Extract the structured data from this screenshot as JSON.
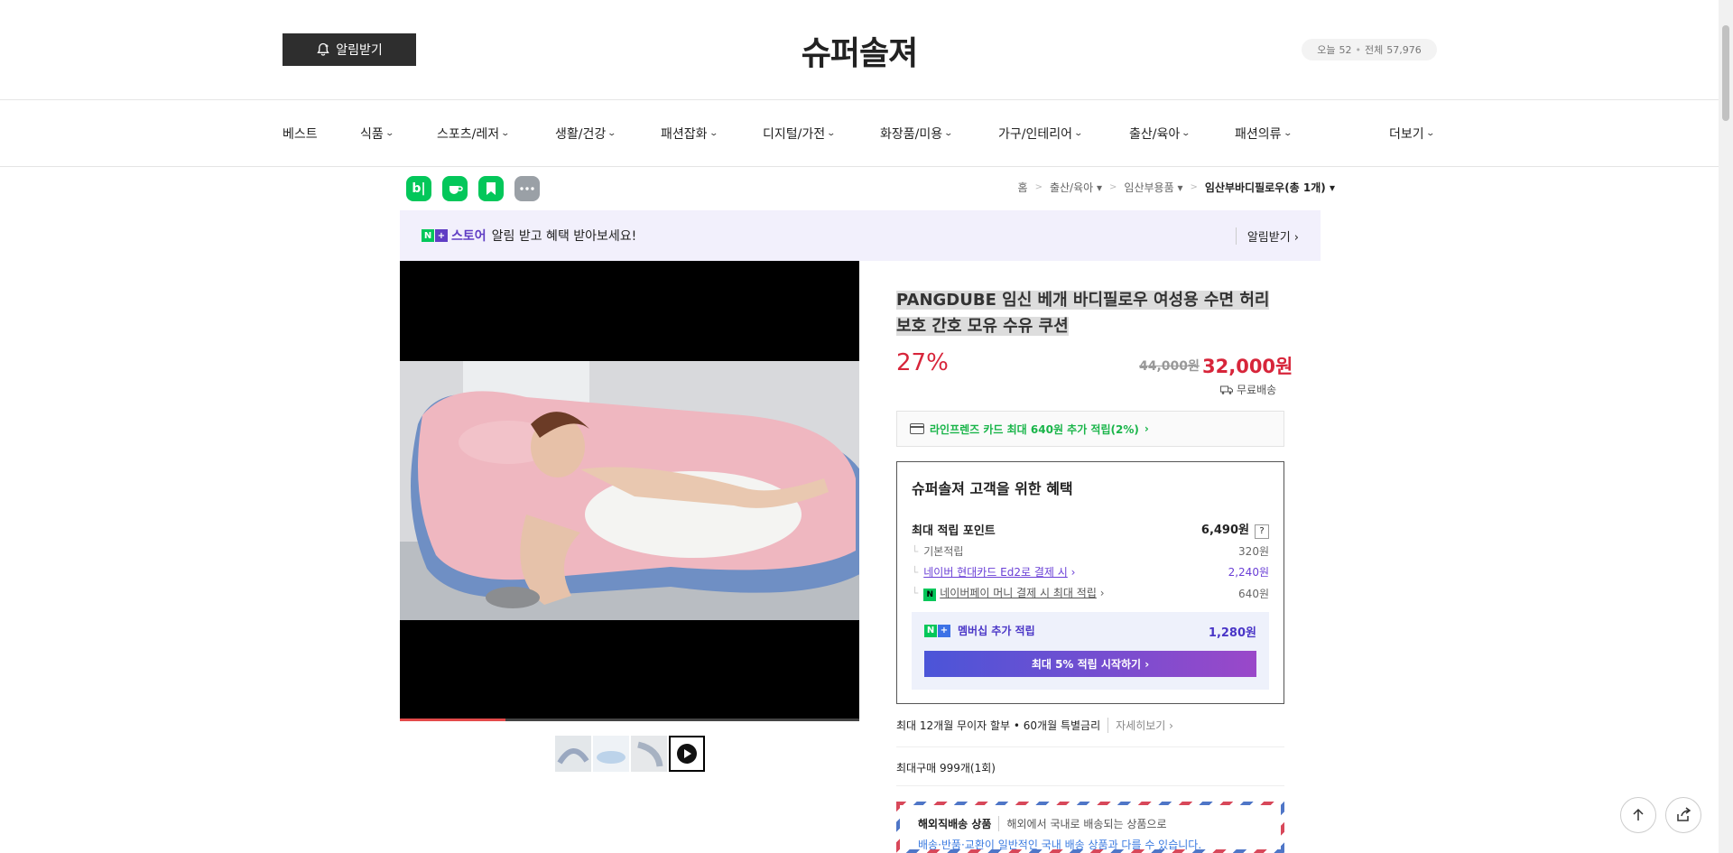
{
  "header": {
    "alert_button": "알림받기",
    "site_title": "슈퍼솔져",
    "visitors_today_label": "오늘",
    "visitors_today": "52",
    "visitors_total_label": "전체",
    "visitors_total": "57,976"
  },
  "nav": {
    "items": [
      {
        "label": "베스트",
        "dropdown": false
      },
      {
        "label": "식품",
        "dropdown": true
      },
      {
        "label": "스포츠/레저",
        "dropdown": true
      },
      {
        "label": "생활/건강",
        "dropdown": true
      },
      {
        "label": "패션잡화",
        "dropdown": true
      },
      {
        "label": "디지털/가전",
        "dropdown": true
      },
      {
        "label": "화장품/미용",
        "dropdown": true
      },
      {
        "label": "가구/인테리어",
        "dropdown": true
      },
      {
        "label": "출산/육아",
        "dropdown": true
      },
      {
        "label": "패션의류",
        "dropdown": true
      }
    ],
    "more": "더보기"
  },
  "share": {
    "blog_glyph": "b|"
  },
  "breadcrumb": {
    "home": "홈",
    "cat1": "출산/육아",
    "cat2": "임산부용품",
    "cat3": "임산부바디필로우(총 1개)"
  },
  "store_banner": {
    "store_word": "스토어",
    "text": "알림 받고 혜택 받아보세요!",
    "link": "알림받기"
  },
  "product": {
    "title": "PANGDUBE 임신 베개 바디필로우 여성용 수면 허리 보호 간호 모유 수유 쿠션",
    "discount": "27%",
    "original_price": "44,000원",
    "sale_price": "32,000원",
    "shipping": "무료배송",
    "card_benefit": "라인프렌즈 카드 최대 640원 추가 적립(2%)",
    "video_progress_percent": 23
  },
  "benefits": {
    "title": "슈퍼솔져 고객을 위한 혜택",
    "max_points_label": "최대 적립 포인트",
    "max_points_value": "6,490원",
    "help": "?",
    "basic_label": "기본적립",
    "basic_value": "320원",
    "card_label": "네이버 현대카드 Ed2로 결제 시",
    "card_value": "2,240원",
    "npay_label": "네이버페이 머니 결제 시 최대 적립",
    "npay_value": "640원",
    "membership_label": "멤버십 추가 적립",
    "membership_value": "1,280원",
    "membership_button": "최대 5% 적립 시작하기"
  },
  "installment": {
    "text": "최대 12개월 무이자 할부 • 60개월 특별금리",
    "more": "자세히보기"
  },
  "max_purchase": "최대구매 999개(1회)",
  "overseas": {
    "title": "해외직배송 상품",
    "desc": "해외에서 국내로 배송되는 상품으로",
    "note": "배송·반품·교환이 일반적인 국내 배송 상품과 다를 수 있습니다."
  },
  "colors": {
    "accent_red": "#d7253a",
    "naver_green": "#03c75a",
    "purple": "#6a3fd6"
  }
}
